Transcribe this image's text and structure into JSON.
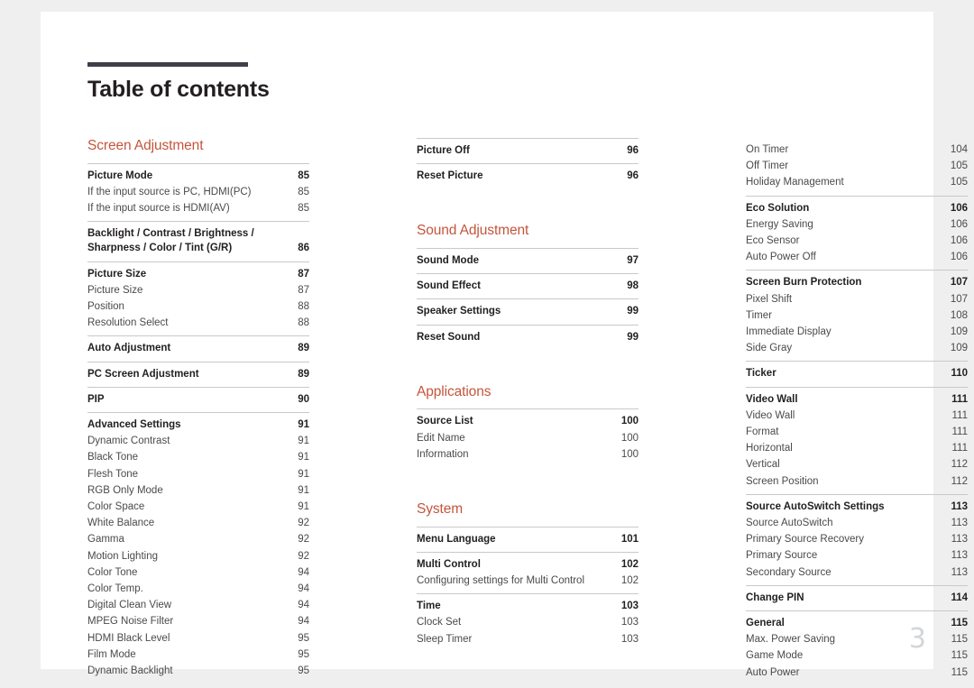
{
  "document": {
    "title": "Table of contents",
    "folio": "3",
    "accent_color": "#c4553c",
    "rule_color": "#3f3f4a",
    "page_background": "#ffffff",
    "canvas_background": "#efefef"
  },
  "columns": [
    {
      "id": "column-1",
      "blocks": [
        {
          "type": "section",
          "heading": "Screen Adjustment"
        },
        {
          "type": "group",
          "entries": [
            {
              "level": "head",
              "label": "Picture Mode",
              "page": "85"
            },
            {
              "level": "sub",
              "label": "If the input source is PC, HDMI(PC)",
              "page": "85"
            },
            {
              "level": "sub",
              "label": "If the input source is HDMI(AV)",
              "page": "85"
            }
          ]
        },
        {
          "type": "group",
          "entries": [
            {
              "level": "head",
              "wrap": true,
              "label": "Backlight / Contrast / Brightness / Sharpness / Color / Tint (G/R)",
              "page": "86"
            }
          ]
        },
        {
          "type": "group",
          "entries": [
            {
              "level": "head",
              "label": "Picture Size",
              "page": "87"
            },
            {
              "level": "sub",
              "label": "Picture Size",
              "page": "87"
            },
            {
              "level": "sub",
              "label": "Position",
              "page": "88"
            },
            {
              "level": "sub",
              "label": "Resolution Select",
              "page": "88"
            }
          ]
        },
        {
          "type": "group",
          "entries": [
            {
              "level": "head",
              "label": "Auto Adjustment",
              "page": "89"
            }
          ]
        },
        {
          "type": "group",
          "entries": [
            {
              "level": "head",
              "label": "PC Screen Adjustment",
              "page": "89"
            }
          ]
        },
        {
          "type": "group",
          "entries": [
            {
              "level": "head",
              "label": "PIP",
              "page": "90"
            }
          ]
        },
        {
          "type": "group",
          "entries": [
            {
              "level": "head",
              "label": "Advanced Settings",
              "page": "91"
            },
            {
              "level": "sub",
              "label": "Dynamic Contrast",
              "page": "91"
            },
            {
              "level": "sub",
              "label": "Black Tone",
              "page": "91"
            },
            {
              "level": "sub",
              "label": "Flesh Tone",
              "page": "91"
            },
            {
              "level": "sub",
              "label": "RGB Only Mode",
              "page": "91"
            },
            {
              "level": "sub",
              "label": "Color Space",
              "page": "91"
            },
            {
              "level": "sub",
              "label": "White Balance",
              "page": "92"
            },
            {
              "level": "sub",
              "label": "Gamma",
              "page": "92"
            },
            {
              "level": "sub",
              "label": "Motion Lighting",
              "page": "92"
            },
            {
              "level": "sub",
              "label": "Color Tone",
              "page": "94"
            },
            {
              "level": "sub",
              "label": "Color Temp.",
              "page": "94"
            },
            {
              "level": "sub",
              "label": "Digital Clean View",
              "page": "94"
            },
            {
              "level": "sub",
              "label": "MPEG Noise Filter",
              "page": "94"
            },
            {
              "level": "sub",
              "label": "HDMI Black Level",
              "page": "95"
            },
            {
              "level": "sub",
              "label": "Film Mode",
              "page": "95"
            },
            {
              "level": "sub",
              "label": "Dynamic Backlight",
              "page": "95"
            }
          ]
        }
      ]
    },
    {
      "id": "column-2",
      "blocks": [
        {
          "type": "group",
          "entries": [
            {
              "level": "head",
              "label": "Picture Off",
              "page": "96"
            }
          ]
        },
        {
          "type": "group",
          "entries": [
            {
              "level": "head",
              "label": "Reset Picture",
              "page": "96"
            }
          ]
        },
        {
          "type": "section",
          "heading": "Sound Adjustment",
          "spaced": true
        },
        {
          "type": "group",
          "entries": [
            {
              "level": "head",
              "label": "Sound Mode",
              "page": "97"
            }
          ]
        },
        {
          "type": "group",
          "entries": [
            {
              "level": "head",
              "label": "Sound Effect",
              "page": "98"
            }
          ]
        },
        {
          "type": "group",
          "entries": [
            {
              "level": "head",
              "label": "Speaker Settings",
              "page": "99"
            }
          ]
        },
        {
          "type": "group",
          "entries": [
            {
              "level": "head",
              "label": "Reset Sound",
              "page": "99"
            }
          ]
        },
        {
          "type": "section",
          "heading": "Applications",
          "spaced": true
        },
        {
          "type": "group",
          "entries": [
            {
              "level": "head",
              "label": "Source List",
              "page": "100"
            },
            {
              "level": "sub",
              "label": "Edit Name",
              "page": "100"
            },
            {
              "level": "sub",
              "label": "Information",
              "page": "100"
            }
          ]
        },
        {
          "type": "section",
          "heading": "System",
          "spaced": true
        },
        {
          "type": "group",
          "entries": [
            {
              "level": "head",
              "label": "Menu Language",
              "page": "101"
            }
          ]
        },
        {
          "type": "group",
          "entries": [
            {
              "level": "head",
              "label": "Multi Control",
              "page": "102"
            },
            {
              "level": "sub",
              "label": "Configuring settings for Multi Control",
              "page": "102"
            }
          ]
        },
        {
          "type": "group",
          "entries": [
            {
              "level": "head",
              "label": "Time",
              "page": "103"
            },
            {
              "level": "sub",
              "label": "Clock Set",
              "page": "103"
            },
            {
              "level": "sub",
              "label": "Sleep Timer",
              "page": "103"
            }
          ]
        }
      ]
    },
    {
      "id": "column-3",
      "blocks": [
        {
          "type": "group",
          "noborder": true,
          "entries": [
            {
              "level": "sub",
              "label": "On Timer",
              "page": "104"
            },
            {
              "level": "sub",
              "label": "Off Timer",
              "page": "105"
            },
            {
              "level": "sub",
              "label": "Holiday Management",
              "page": "105"
            }
          ]
        },
        {
          "type": "group",
          "entries": [
            {
              "level": "head",
              "label": "Eco Solution",
              "page": "106"
            },
            {
              "level": "sub",
              "label": "Energy Saving",
              "page": "106"
            },
            {
              "level": "sub",
              "label": "Eco Sensor",
              "page": "106"
            },
            {
              "level": "sub",
              "label": "Auto Power Off",
              "page": "106"
            }
          ]
        },
        {
          "type": "group",
          "entries": [
            {
              "level": "head",
              "label": "Screen Burn Protection",
              "page": "107"
            },
            {
              "level": "sub",
              "label": "Pixel Shift",
              "page": "107"
            },
            {
              "level": "sub",
              "label": "Timer",
              "page": "108"
            },
            {
              "level": "sub",
              "label": "Immediate Display",
              "page": "109"
            },
            {
              "level": "sub",
              "label": "Side Gray",
              "page": "109"
            }
          ]
        },
        {
          "type": "group",
          "entries": [
            {
              "level": "head",
              "label": "Ticker",
              "page": "110"
            }
          ]
        },
        {
          "type": "group",
          "entries": [
            {
              "level": "head",
              "label": "Video Wall",
              "page": "111"
            },
            {
              "level": "sub",
              "label": "Video Wall",
              "page": "111"
            },
            {
              "level": "sub",
              "label": "Format",
              "page": "111"
            },
            {
              "level": "sub",
              "label": "Horizontal",
              "page": "111"
            },
            {
              "level": "sub",
              "label": "Vertical",
              "page": "112"
            },
            {
              "level": "sub",
              "label": "Screen Position",
              "page": "112"
            }
          ]
        },
        {
          "type": "group",
          "entries": [
            {
              "level": "head",
              "label": "Source AutoSwitch Settings",
              "page": "113"
            },
            {
              "level": "sub",
              "label": "Source AutoSwitch",
              "page": "113"
            },
            {
              "level": "sub",
              "label": "Primary Source Recovery",
              "page": "113"
            },
            {
              "level": "sub",
              "label": "Primary Source",
              "page": "113"
            },
            {
              "level": "sub",
              "label": "Secondary Source",
              "page": "113"
            }
          ]
        },
        {
          "type": "group",
          "entries": [
            {
              "level": "head",
              "label": "Change PIN",
              "page": "114"
            }
          ]
        },
        {
          "type": "group",
          "entries": [
            {
              "level": "head",
              "label": "General",
              "page": "115"
            },
            {
              "level": "sub",
              "label": "Max. Power Saving",
              "page": "115"
            },
            {
              "level": "sub",
              "label": "Game Mode",
              "page": "115"
            },
            {
              "level": "sub",
              "label": "Auto Power",
              "page": "115"
            }
          ]
        }
      ]
    }
  ]
}
